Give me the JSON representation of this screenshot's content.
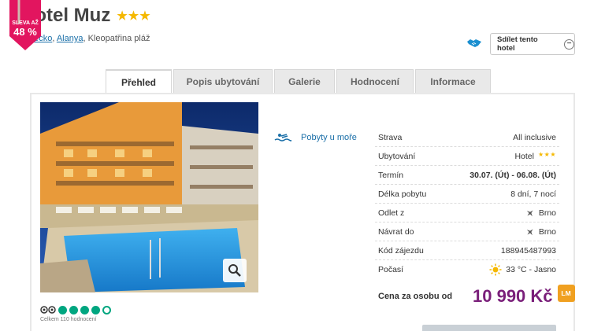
{
  "hotel": {
    "name": "Hotel Muz",
    "stars": "★★★"
  },
  "breadcrumb": {
    "country": "Turecko",
    "separator": ",",
    "city": "Alanya",
    "beach": ", Kleopatřina pláž"
  },
  "share": {
    "label": "Sdílet tento hotel",
    "minus": "−"
  },
  "tabs": [
    "Přehled",
    "Popis ubytování",
    "Galerie",
    "Hodnocení",
    "Informace"
  ],
  "badge": {
    "line1": "SLEVA AŽ",
    "line2": "48 %"
  },
  "rating": {
    "score_dots": 4,
    "max_dots": 5,
    "count_text": "Celkem 110 hodnocení"
  },
  "beach_link": "Pobyty u moře",
  "info": {
    "strava": {
      "label": "Strava",
      "value": "All inclusive"
    },
    "ubytovani": {
      "label": "Ubytování",
      "value": "Hotel",
      "stars": "★★★"
    },
    "termin": {
      "label": "Termín",
      "value": "30.07. (Út) - 06.08. (Út)"
    },
    "delka": {
      "label": "Délka pobytu",
      "value": "8 dní, 7 nocí"
    },
    "odlet": {
      "label": "Odlet z",
      "value": "Brno"
    },
    "navrat": {
      "label": "Návrat do",
      "value": "Brno"
    },
    "kod": {
      "label": "Kód zájezdu",
      "value": "188945487993"
    },
    "pocasi": {
      "label": "Počasí",
      "value": "33 °C - Jasno"
    }
  },
  "price": {
    "label": "Cena za osobu od",
    "value": "10 990 Kč",
    "lm": "LM"
  },
  "colors": {
    "price": "#7a1f7a",
    "link": "#1a6fa8",
    "stars": "#f5b800",
    "lm": "#f0a020",
    "tripadvisor": "#00a680"
  }
}
